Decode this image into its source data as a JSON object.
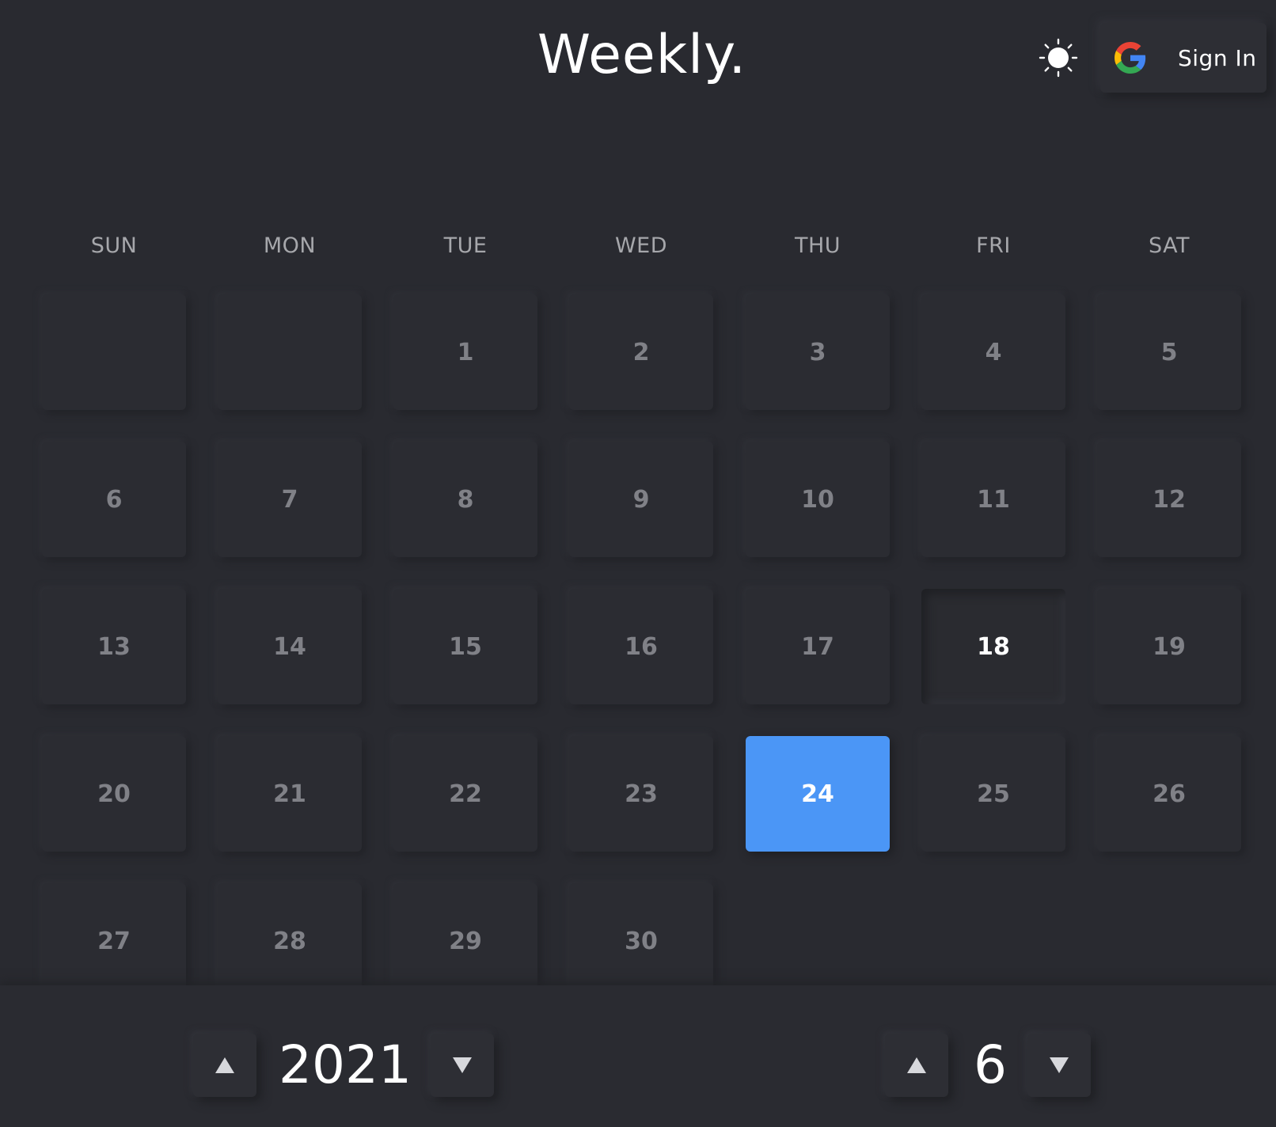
{
  "header": {
    "title": "Weekly.",
    "theme_toggle_icon": "sun-icon",
    "signin_icon": "google-icon",
    "signin_label": "Sign In"
  },
  "calendar": {
    "weekdays": [
      "SUN",
      "MON",
      "TUE",
      "WED",
      "THU",
      "FRI",
      "SAT"
    ],
    "first_weekday_index": 2,
    "days": [
      "1",
      "2",
      "3",
      "4",
      "5",
      "6",
      "7",
      "8",
      "9",
      "10",
      "11",
      "12",
      "13",
      "14",
      "15",
      "16",
      "17",
      "18",
      "19",
      "20",
      "21",
      "22",
      "23",
      "24",
      "25",
      "26",
      "27",
      "28",
      "29",
      "30"
    ],
    "selected_day": "18",
    "today_day": "24",
    "today_color": "#4b96f6"
  },
  "footer": {
    "year": "2021",
    "month": "6",
    "increment_icon": "triangle-up-icon",
    "decrement_icon": "triangle-down-icon"
  }
}
